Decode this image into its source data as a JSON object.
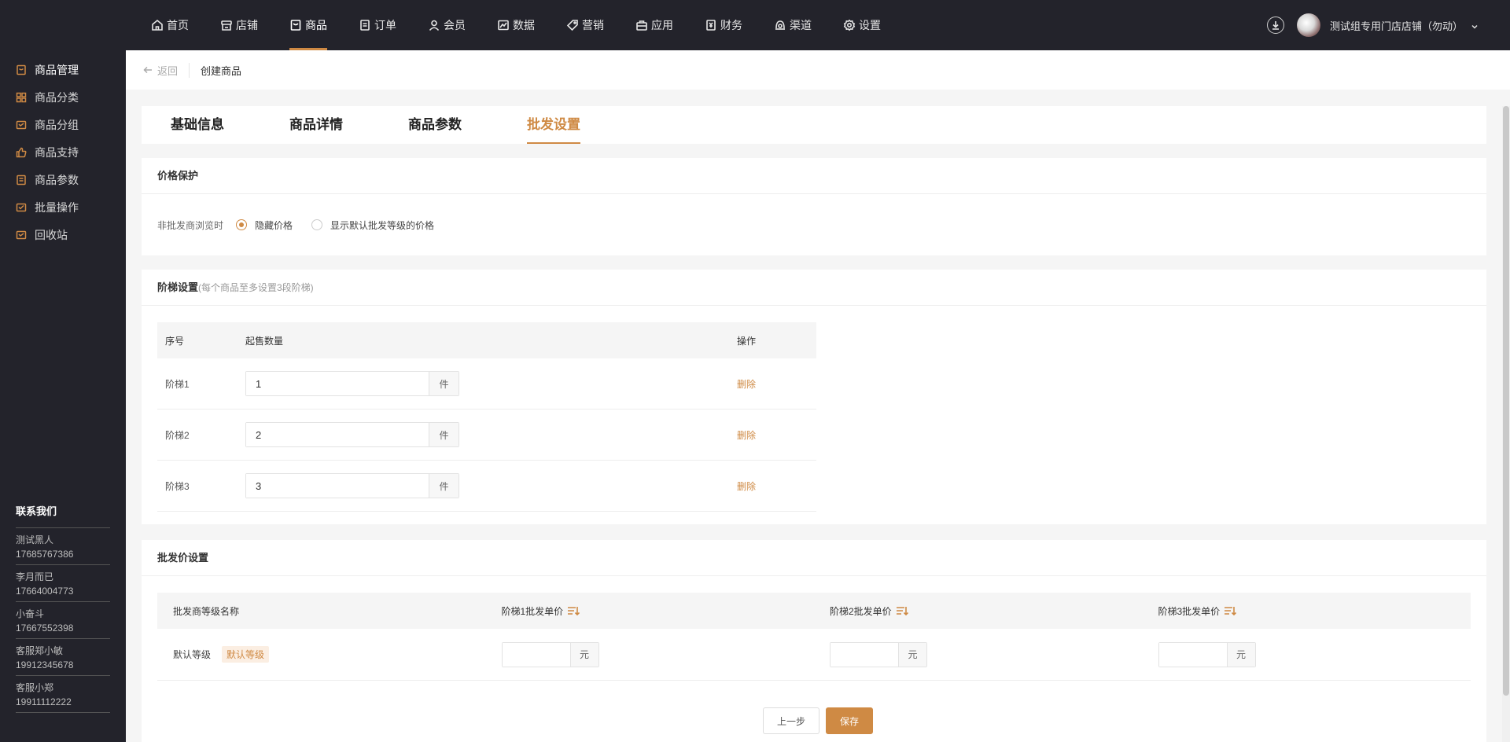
{
  "nav": [
    {
      "label": "首页",
      "icon": "home-icon"
    },
    {
      "label": "店铺",
      "icon": "store-icon"
    },
    {
      "label": "商品",
      "icon": "goods-icon",
      "active": true
    },
    {
      "label": "订单",
      "icon": "order-icon"
    },
    {
      "label": "会员",
      "icon": "member-icon"
    },
    {
      "label": "数据",
      "icon": "chart-icon"
    },
    {
      "label": "营销",
      "icon": "tag-icon"
    },
    {
      "label": "应用",
      "icon": "app-icon"
    },
    {
      "label": "财务",
      "icon": "finance-icon"
    },
    {
      "label": "渠道",
      "icon": "channel-icon"
    },
    {
      "label": "设置",
      "icon": "gear-icon"
    }
  ],
  "user": {
    "store_name": "测试组专用门店店铺（勿动）"
  },
  "sidebar": {
    "items": [
      {
        "label": "商品管理",
        "icon": "goods-manage-icon",
        "active": true
      },
      {
        "label": "商品分类",
        "icon": "category-icon"
      },
      {
        "label": "商品分组",
        "icon": "group-icon"
      },
      {
        "label": "商品支持",
        "icon": "thumb-up-icon"
      },
      {
        "label": "商品参数",
        "icon": "param-icon"
      },
      {
        "label": "批量操作",
        "icon": "batch-icon"
      },
      {
        "label": "回收站",
        "icon": "recycle-icon"
      }
    ],
    "contact_title": "联系我们",
    "contacts": [
      {
        "name": "测试黑人",
        "phone": "17685767386"
      },
      {
        "name": "李月而已",
        "phone": "17664004773"
      },
      {
        "name": "小奋斗",
        "phone": "17667552398"
      },
      {
        "name": "客服郑小敏",
        "phone": "19912345678"
      },
      {
        "name": "客服小郑",
        "phone": "19911112222"
      }
    ]
  },
  "breadcrumb": {
    "back_label": "返回",
    "title": "创建商品"
  },
  "tabs": [
    {
      "label": "基础信息"
    },
    {
      "label": "商品详情"
    },
    {
      "label": "商品参数"
    },
    {
      "label": "批发设置",
      "active": true
    }
  ],
  "price_protection": {
    "title": "价格保护",
    "label": "非批发商浏览时",
    "options": [
      "隐藏价格",
      "显示默认批发等级的价格"
    ],
    "selected": "隐藏价格"
  },
  "tier": {
    "title": "阶梯设置",
    "subtitle": "(每个商品至多设置3段阶梯)",
    "headers": [
      "序号",
      "起售数量",
      "操作"
    ],
    "rows": [
      {
        "name": "阶梯1",
        "qty": "1",
        "unit": "件",
        "action": "删除"
      },
      {
        "name": "阶梯2",
        "qty": "2",
        "unit": "件",
        "action": "删除"
      },
      {
        "name": "阶梯3",
        "qty": "3",
        "unit": "件",
        "action": "删除"
      }
    ]
  },
  "wholesale": {
    "title": "批发价设置",
    "headers": [
      "批发商等级名称",
      "阶梯1批发单价",
      "阶梯2批发单价",
      "阶梯3批发单价"
    ],
    "row": {
      "level": "默认等级",
      "tag": "默认等级",
      "unit": "元",
      "prices": [
        "",
        "",
        ""
      ]
    }
  },
  "buttons": {
    "prev": "上一步",
    "save": "保存"
  },
  "colors": {
    "accent": "#cf8a44",
    "topbar": "#23232b"
  }
}
